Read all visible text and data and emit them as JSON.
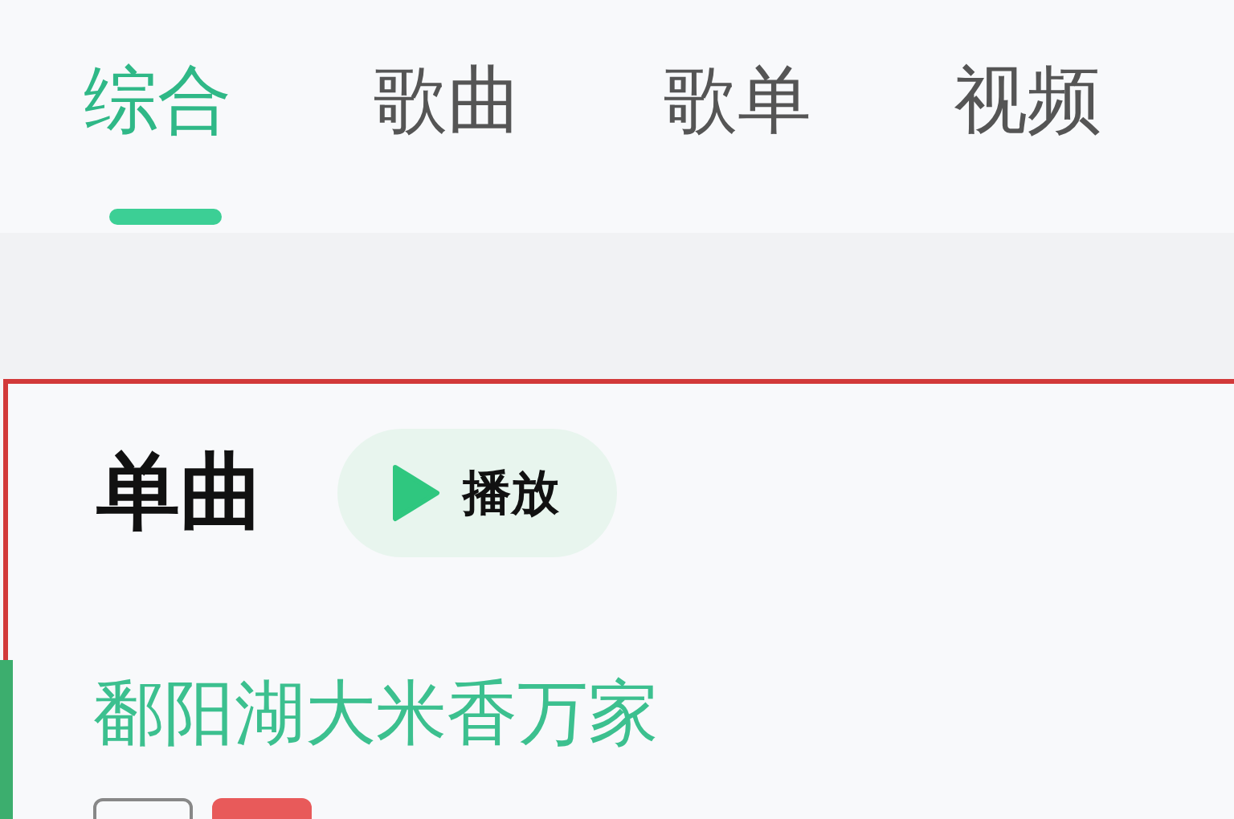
{
  "tabs": [
    {
      "label": "综合",
      "selected": true
    },
    {
      "label": "歌曲",
      "selected": false
    },
    {
      "label": "歌单",
      "selected": false
    },
    {
      "label": "视频",
      "selected": false
    }
  ],
  "section": {
    "title": "单曲",
    "play_button": "播放"
  },
  "songs": [
    {
      "title": "鄱阳湖大米香万家",
      "playing": true
    }
  ]
}
